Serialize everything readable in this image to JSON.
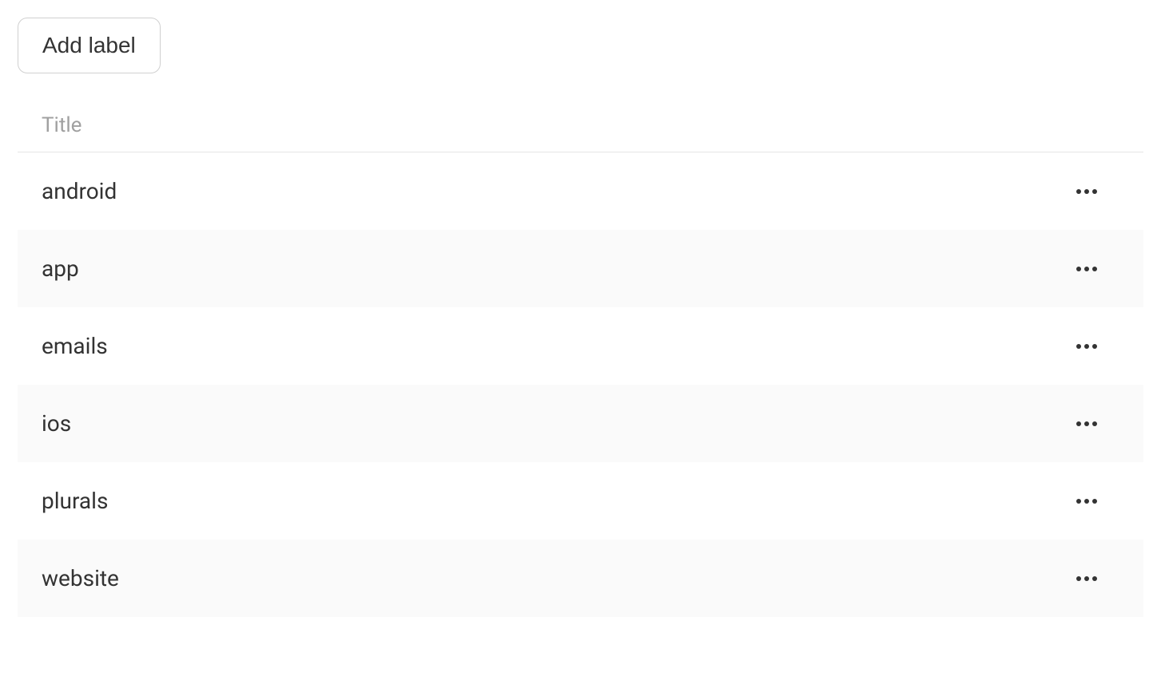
{
  "toolbar": {
    "add_label": "Add label"
  },
  "table": {
    "header": {
      "title": "Title"
    },
    "rows": [
      {
        "title": "android"
      },
      {
        "title": "app"
      },
      {
        "title": "emails"
      },
      {
        "title": "ios"
      },
      {
        "title": "plurals"
      },
      {
        "title": "website"
      }
    ]
  }
}
